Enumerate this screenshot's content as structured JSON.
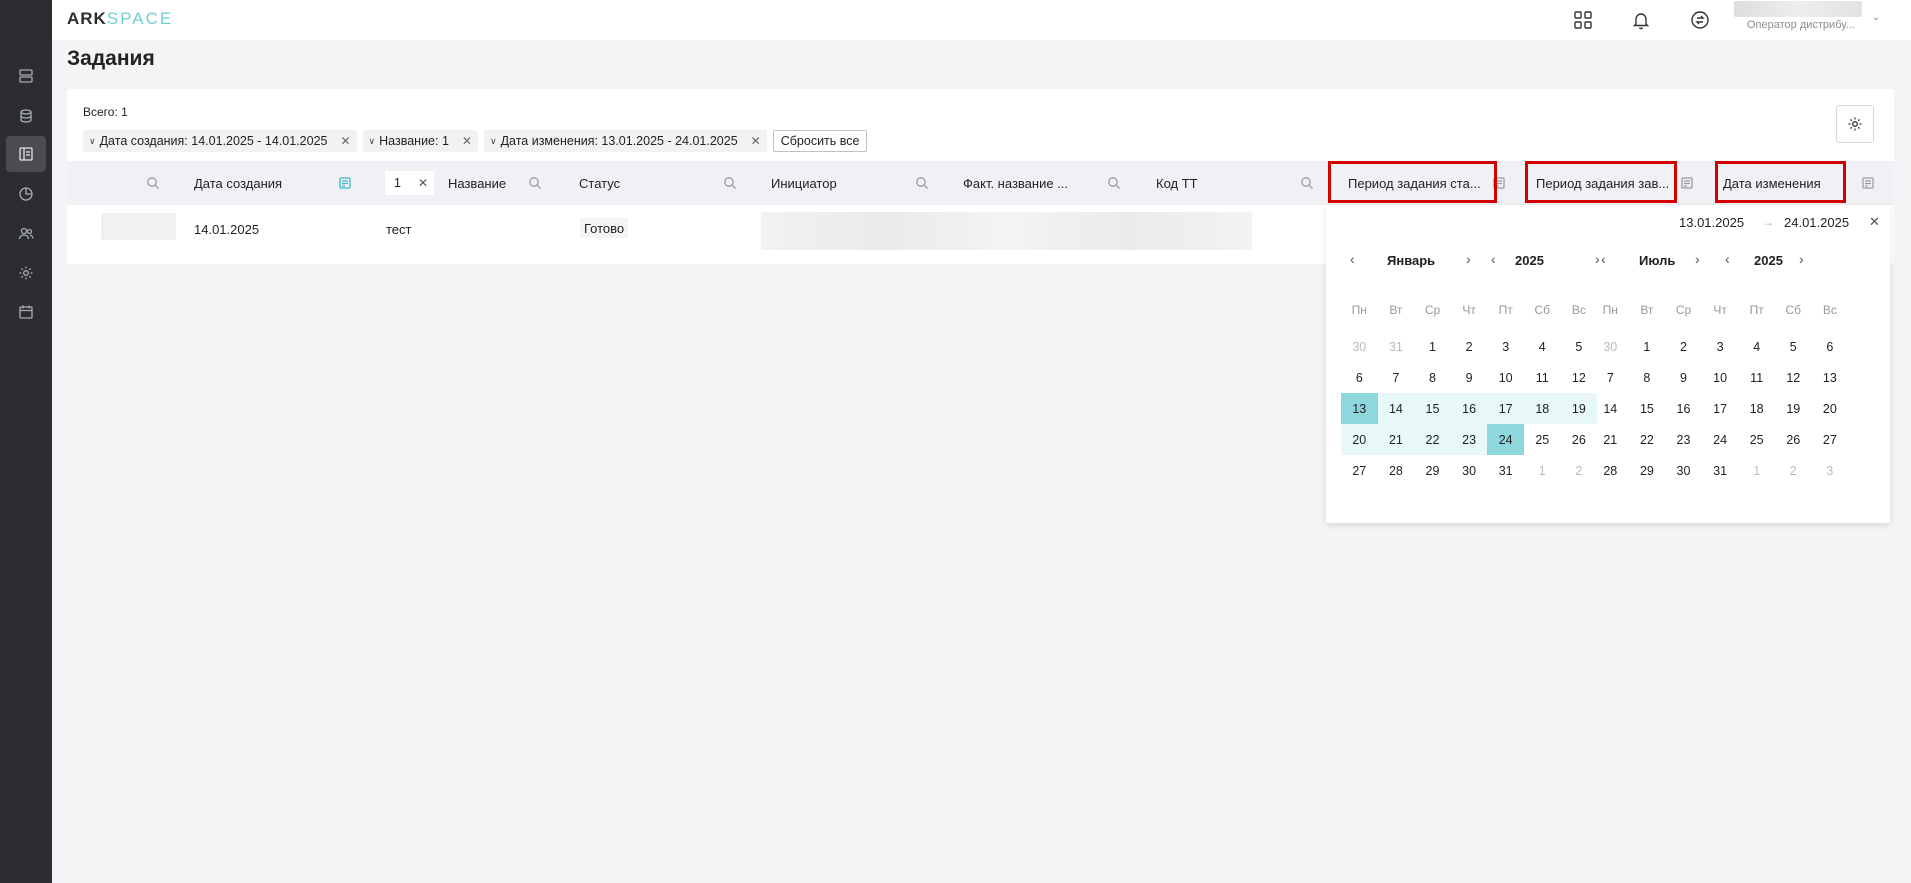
{
  "header": {
    "logo_primary": "ARK",
    "logo_secondary": "SPACE",
    "user_role": "Оператор дистрибу..."
  },
  "page": {
    "title": "Задания"
  },
  "table_summary": {
    "total": "Всего: 1"
  },
  "filters": [
    {
      "label": "Дата создания: 14.01.2025 - 14.01.2025"
    },
    {
      "label": "Название: 1"
    },
    {
      "label": "Дата изменения: 13.01.2025 - 24.01.2025"
    }
  ],
  "reset_label": "Сбросить все",
  "columns": {
    "created": "Дата создания",
    "name_filter_value": "1",
    "name": "Название",
    "status": "Статус",
    "initiator": "Инициатор",
    "fact_name": "Факт. название ...",
    "tt_code": "Код ТТ",
    "period_start": "Период задания ста...",
    "period_end": "Период задания зав...",
    "modified": "Дата изменения"
  },
  "row": {
    "created": "14.01.2025",
    "name": "тест",
    "status": "Готово"
  },
  "picker": {
    "from": "13.01.2025",
    "arrow": "→",
    "to": "24.01.2025",
    "left": {
      "month": "Январь",
      "year": "2025"
    },
    "right": {
      "month": "Июль",
      "year": "2025"
    },
    "weekdays": [
      "Пн",
      "Вт",
      "Ср",
      "Чт",
      "Пт",
      "Сб",
      "Вс"
    ],
    "left_days": [
      [
        "30",
        "31",
        "1",
        "2",
        "3",
        "4",
        "5"
      ],
      [
        "6",
        "7",
        "8",
        "9",
        "10",
        "11",
        "12"
      ],
      [
        "13",
        "14",
        "15",
        "16",
        "17",
        "18",
        "19"
      ],
      [
        "20",
        "21",
        "22",
        "23",
        "24",
        "25",
        "26"
      ],
      [
        "27",
        "28",
        "29",
        "30",
        "31",
        "1",
        "2"
      ]
    ],
    "right_days": [
      [
        "30",
        "1",
        "2",
        "3",
        "4",
        "5",
        "6"
      ],
      [
        "7",
        "8",
        "9",
        "10",
        "11",
        "12",
        "13"
      ],
      [
        "14",
        "15",
        "16",
        "17",
        "18",
        "19",
        "20"
      ],
      [
        "21",
        "22",
        "23",
        "24",
        "25",
        "26",
        "27"
      ],
      [
        "28",
        "29",
        "30",
        "31",
        "1",
        "2",
        "3"
      ]
    ]
  }
}
